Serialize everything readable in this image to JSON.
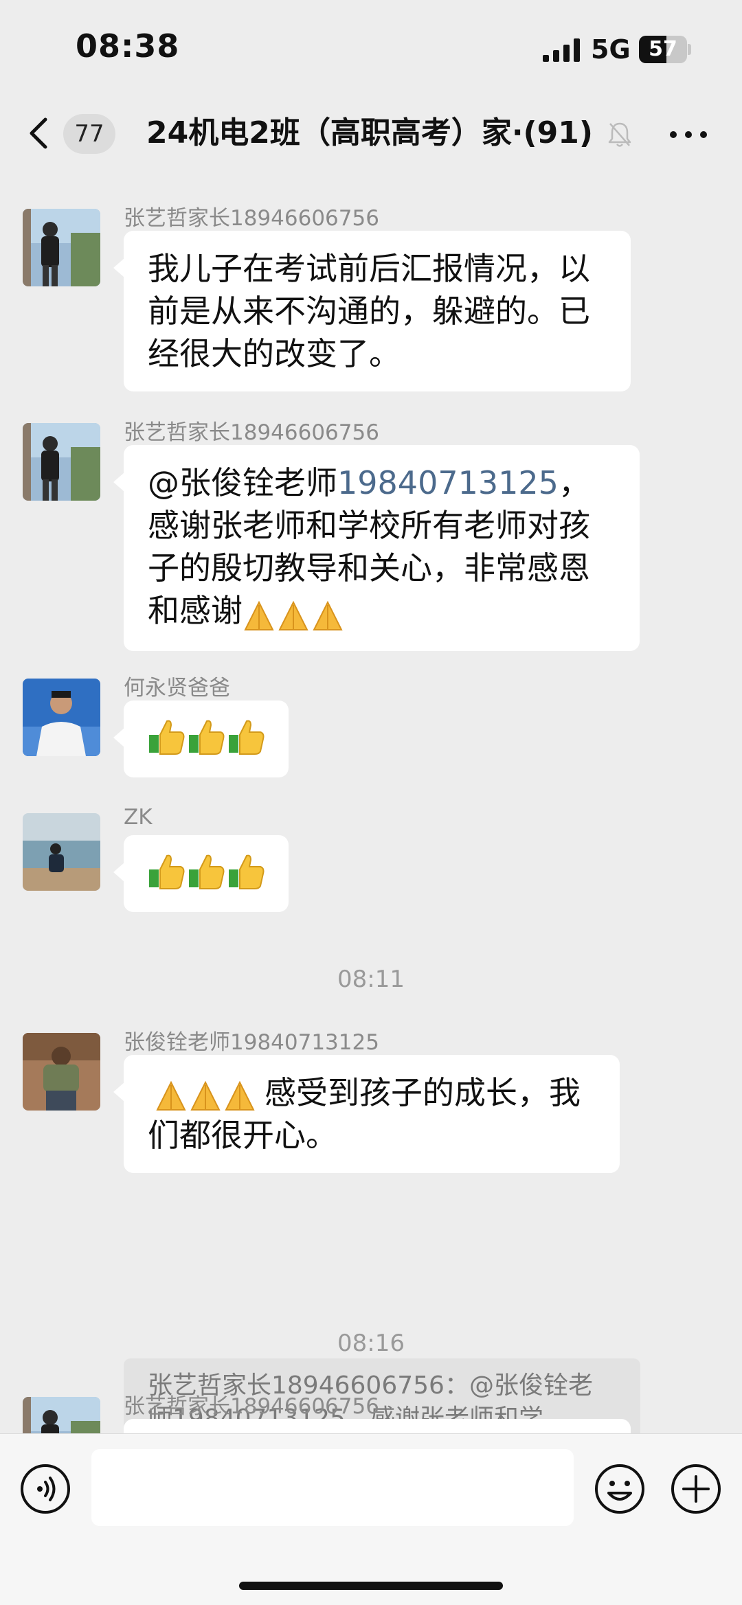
{
  "status_bar": {
    "time": "08:38",
    "network": "5G",
    "battery": "57",
    "battery_level": 0.57
  },
  "header": {
    "unread_count": "77",
    "title": "24机电2班（高职高考）家⋅(91)"
  },
  "messages": [
    {
      "sender": "张艺哲家长18946606756",
      "text": "我儿子在考试前后汇报情况，以前是从来不沟通的，躲避的。已经很大的改变了。"
    },
    {
      "sender": "张艺哲家长18946606756",
      "mention": "@张俊铨老师",
      "mention_phone": "19840713125",
      "text_after": "，感谢张老师和学校所有老师对孩子的殷切教导和关心，非常感恩和感谢",
      "emoji": "🙏🙏🙏"
    },
    {
      "sender": "何永贤爸爸",
      "emoji": "👍👍👍"
    },
    {
      "sender": "ZK",
      "emoji": "👍👍👍"
    },
    {
      "sender": "张俊铨老师19840713125",
      "emoji": "🙏🙏🙏",
      "text": "感受到孩子的成长，我们都很开心。",
      "quote": "张艺哲家长18946606756：@张俊铨老师19840713125，感谢张老师和学..."
    },
    {
      "sender": "张艺哲家长18946606756"
    }
  ],
  "timestamps": [
    "08:11",
    "08:16"
  ],
  "input": {
    "placeholder": ""
  },
  "icons": {
    "back": "chevron-left-icon",
    "mute": "bell-off-icon",
    "more": "ellipsis-icon",
    "voice": "voice-icon",
    "emoji": "smiley-icon",
    "plus": "plus-circle-icon"
  },
  "colors": {
    "background": "#ededed",
    "bubble": "#ffffff",
    "mention": "#4c6a8c"
  }
}
